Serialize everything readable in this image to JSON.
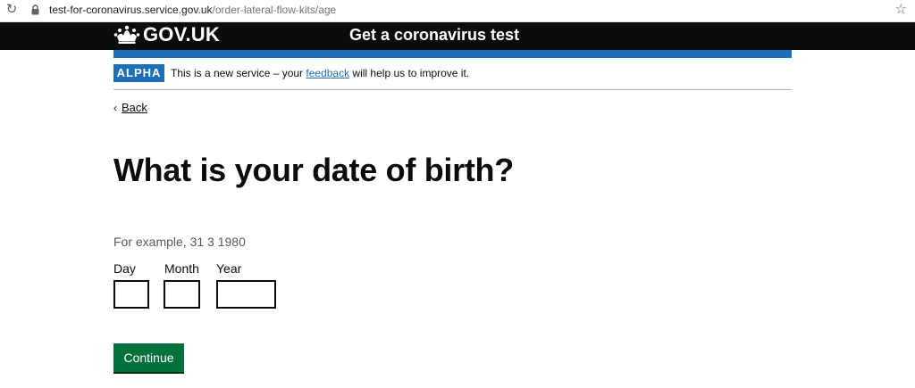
{
  "browser": {
    "url_host": "test-for-coronavirus.service.gov.uk",
    "url_path": "/order-lateral-flow-kits/age",
    "reload_icon": "reload-icon",
    "lock_icon": "lock-icon",
    "star_icon": "star-icon"
  },
  "header": {
    "logo_icon": "crown-icon",
    "wordmark": "GOV.UK",
    "service_name": "Get a coronavirus test",
    "stripe_color": "#1d70b8"
  },
  "phase_banner": {
    "tag": "ALPHA",
    "text_before": "This is a new service – your ",
    "link_text": "feedback",
    "text_after": " will help us to improve it."
  },
  "back_link": {
    "chevron": "‹",
    "label": "Back"
  },
  "title": "What is your date of birth?",
  "hint": "For example, 31 3 1980",
  "date_fields": {
    "day_label": "Day",
    "month_label": "Month",
    "year_label": "Year",
    "day_value": "",
    "month_value": "",
    "year_value": ""
  },
  "continue_label": "Continue",
  "colors": {
    "header_bg": "#0b0c0c",
    "tag_bg": "#1d70b8",
    "button_bg": "#00703c"
  }
}
